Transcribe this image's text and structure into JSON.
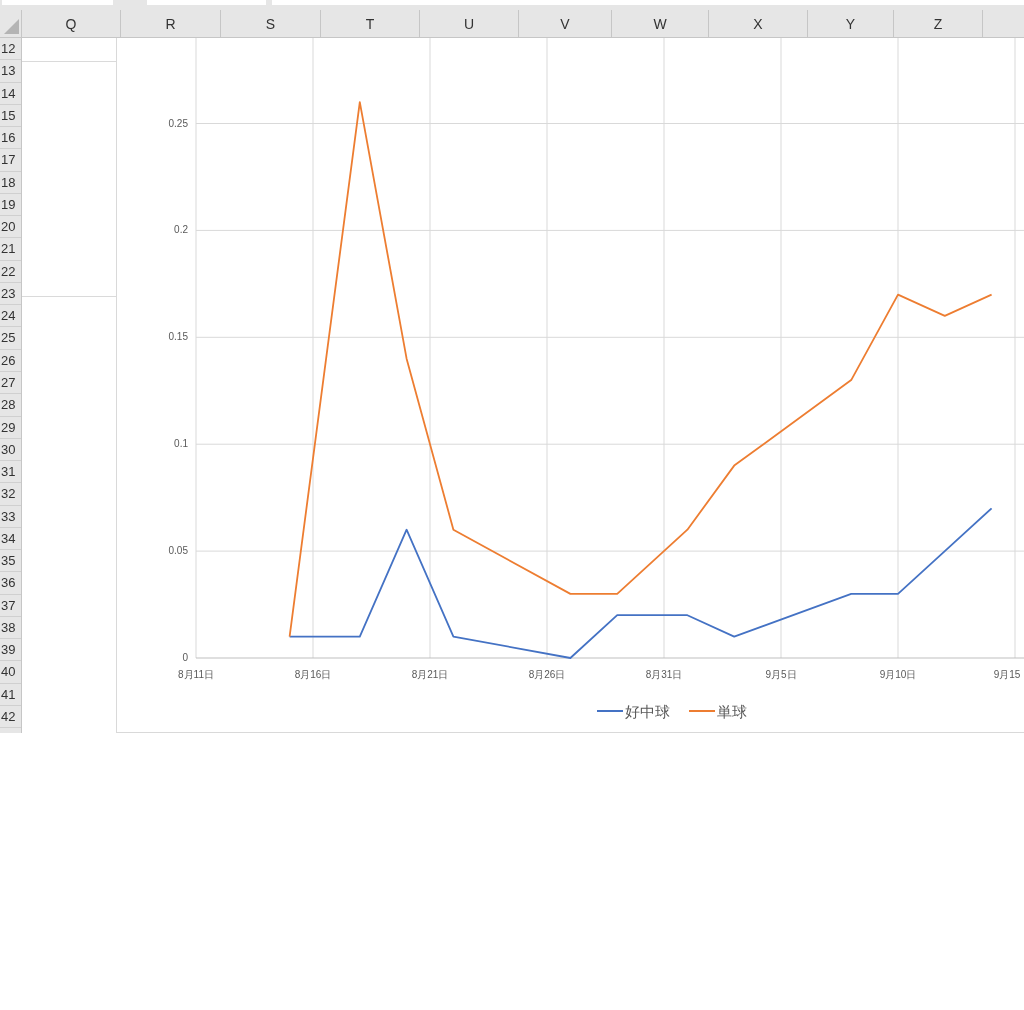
{
  "columns": [
    "Q",
    "R",
    "S",
    "T",
    "U",
    "V",
    "W",
    "X",
    "Y",
    "Z"
  ],
  "rows": [
    "12",
    "13",
    "14",
    "15",
    "16",
    "17",
    "18",
    "19",
    "20",
    "21",
    "22",
    "23",
    "24",
    "25",
    "26",
    "27",
    "28",
    "29",
    "30",
    "31",
    "32",
    "33",
    "34",
    "35",
    "36",
    "37",
    "38",
    "39",
    "40",
    "41",
    "42"
  ],
  "chart": {
    "chart_data": {
      "type": "line",
      "ylim": [
        0,
        0.29
      ],
      "grid": true,
      "legend": "bottom",
      "categories": [
        "8月11日",
        null,
        null,
        null,
        null,
        "8月16日",
        null,
        null,
        null,
        null,
        "8月21日",
        null,
        null,
        null,
        null,
        "8月26日",
        null,
        null,
        null,
        null,
        "8月31日",
        null,
        null,
        null,
        null,
        "9月5日",
        null,
        null,
        null,
        null,
        "9月10日",
        null,
        null,
        null,
        null,
        "9月15"
      ],
      "yticks": [
        {
          "value": 0,
          "label": "0"
        },
        {
          "value": 0.05,
          "label": "0.05"
        },
        {
          "value": 0.1,
          "label": "0.1"
        },
        {
          "value": 0.15,
          "label": "0.15"
        },
        {
          "value": 0.2,
          "label": "0.2"
        },
        {
          "value": 0.25,
          "label": "0.25"
        }
      ],
      "series": [
        {
          "name": "好中球",
          "color": "#4472c4",
          "values": [
            null,
            null,
            null,
            null,
            0.01,
            null,
            null,
            0.01,
            null,
            0.06,
            null,
            0.01,
            null,
            null,
            null,
            null,
            0,
            null,
            0.02,
            null,
            null,
            0.02,
            null,
            0.01,
            null,
            null,
            null,
            null,
            0.03,
            null,
            0.03,
            null,
            0.05,
            null,
            0.07,
            null
          ]
        },
        {
          "name": "単球",
          "color": "#ed7d31",
          "values": [
            null,
            null,
            null,
            null,
            0.01,
            null,
            null,
            0.26,
            null,
            0.14,
            null,
            0.06,
            null,
            null,
            null,
            null,
            0.03,
            null,
            0.03,
            null,
            null,
            0.06,
            null,
            0.09,
            null,
            null,
            null,
            null,
            0.13,
            null,
            0.17,
            null,
            0.16,
            null,
            0.17,
            null
          ]
        }
      ]
    }
  }
}
